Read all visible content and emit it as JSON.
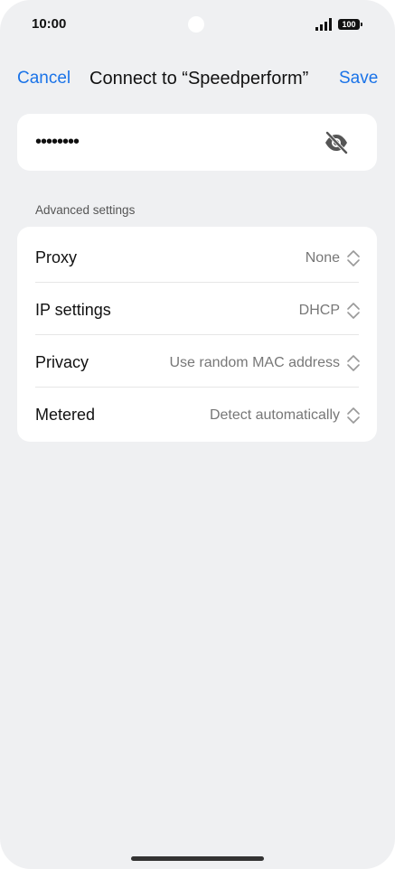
{
  "status_bar": {
    "time": "10:00",
    "battery": "100"
  },
  "header": {
    "cancel_label": "Cancel",
    "title": "Connect to “Speedperform”",
    "save_label": "Save"
  },
  "password": {
    "masked_value": "••••••••",
    "visibility": "hidden"
  },
  "advanced": {
    "label": "Advanced settings",
    "rows": [
      {
        "label": "Proxy",
        "value": "None"
      },
      {
        "label": "IP settings",
        "value": "DHCP"
      },
      {
        "label": "Privacy",
        "value": "Use random MAC address"
      },
      {
        "label": "Metered",
        "value": "Detect automatically"
      }
    ]
  },
  "colors": {
    "accent": "#1a73e8",
    "background": "#eff0f2",
    "card": "#ffffff"
  }
}
